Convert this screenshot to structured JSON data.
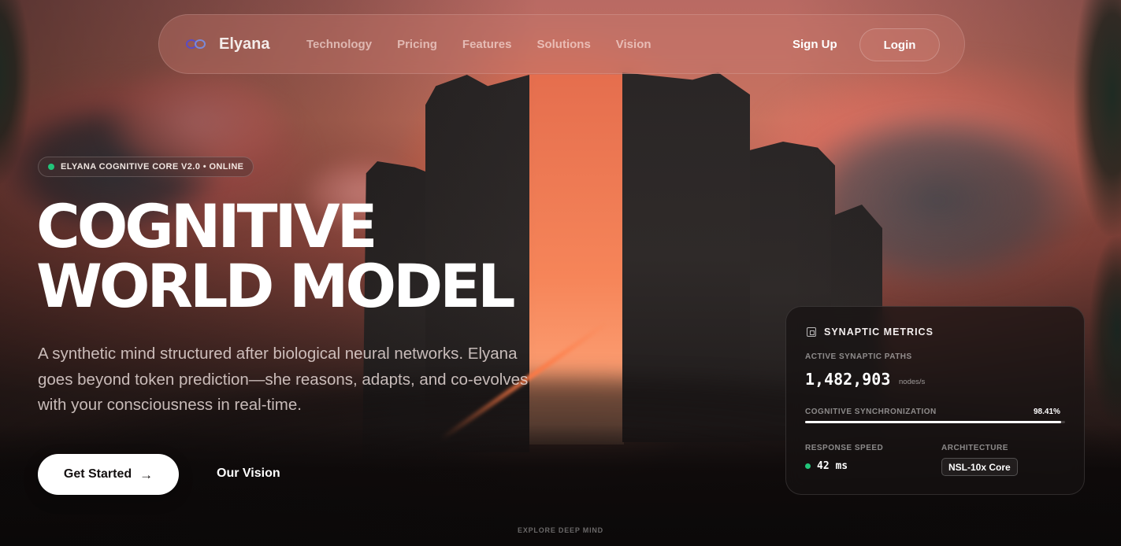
{
  "nav": {
    "brand": "Elyana",
    "links": [
      "Technology",
      "Pricing",
      "Features",
      "Solutions",
      "Vision"
    ],
    "signup": "Sign Up",
    "login": "Login"
  },
  "hero": {
    "badge": "ELYANA COGNITIVE CORE V2.0 • ONLINE",
    "headline_line1": "COGNITIVE",
    "headline_line2": "WORLD MODEL",
    "subtitle": "A synthetic mind structured after biological neural networks. Elyana goes beyond token prediction—she reasons, adapts, and co-evolves with your consciousness in real-time.",
    "primary_cta": "Get Started",
    "secondary_cta": "Our Vision",
    "scroll_hint": "EXPLORE DEEP MIND"
  },
  "metrics": {
    "title": "SYNAPTIC METRICS",
    "paths_label": "ACTIVE SYNAPTIC PATHS",
    "paths_value": "1,482,903",
    "paths_unit": "nodes/s",
    "sync_label": "COGNITIVE SYNCHRONIZATION",
    "sync_value": "98.41%",
    "sync_fraction": 0.9841,
    "speed_label": "RESPONSE SPEED",
    "speed_value": "42 ms",
    "arch_label": "ARCHITECTURE",
    "arch_value": "NSL-10x Core"
  },
  "colors": {
    "status_green": "#22c57a",
    "brand_purple": "#5b4cc4"
  },
  "icons": {
    "brand": "infinity-logo-icon",
    "arrow": "arrow-right-icon",
    "chip": "cpu-chip-icon"
  }
}
